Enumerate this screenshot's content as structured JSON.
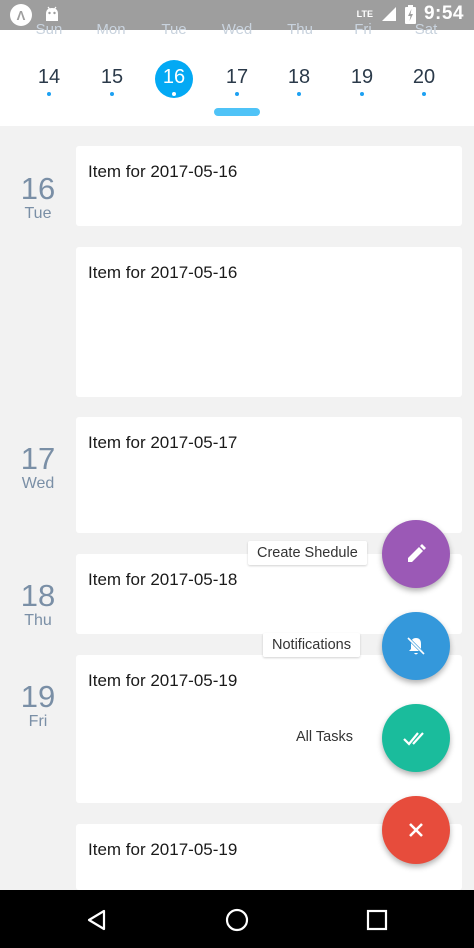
{
  "status_bar": {
    "app_icon_glyph": "Λ",
    "network": "LTE",
    "time": "9:54"
  },
  "calendar": {
    "weekdays": [
      "Sun",
      "Mon",
      "Tue",
      "Wed",
      "Thu",
      "Fri",
      "Sat"
    ],
    "days": [
      "14",
      "15",
      "16",
      "17",
      "18",
      "19",
      "20"
    ],
    "selected_day": "16",
    "accent_color": "#03a9f4"
  },
  "agenda": {
    "groups": [
      {
        "day": "16",
        "weekday": "Tue"
      },
      {
        "day": "17",
        "weekday": "Wed"
      },
      {
        "day": "18",
        "weekday": "Thu"
      },
      {
        "day": "19",
        "weekday": "Fri"
      }
    ],
    "items": [
      {
        "text": "Item for 2017-05-16"
      },
      {
        "text": "Item for 2017-05-16"
      },
      {
        "text": "Item for 2017-05-17"
      },
      {
        "text": "Item for 2017-05-18"
      },
      {
        "text": "Item for 2017-05-19"
      },
      {
        "text": "Item for 2017-05-19"
      }
    ]
  },
  "fab_menu": {
    "actions": [
      {
        "label": "Create Shedule",
        "icon": "pencil-icon",
        "color": "#9b59b6"
      },
      {
        "label": "Notifications",
        "icon": "bell-off-icon",
        "color": "#3498db"
      },
      {
        "label": "All Tasks",
        "icon": "double-check-icon",
        "color": "#1abc9c"
      }
    ],
    "close": {
      "icon": "close-icon",
      "color": "#e74c3c"
    }
  },
  "nav_bar": {
    "buttons": [
      "back-icon",
      "home-icon",
      "recents-icon"
    ]
  }
}
